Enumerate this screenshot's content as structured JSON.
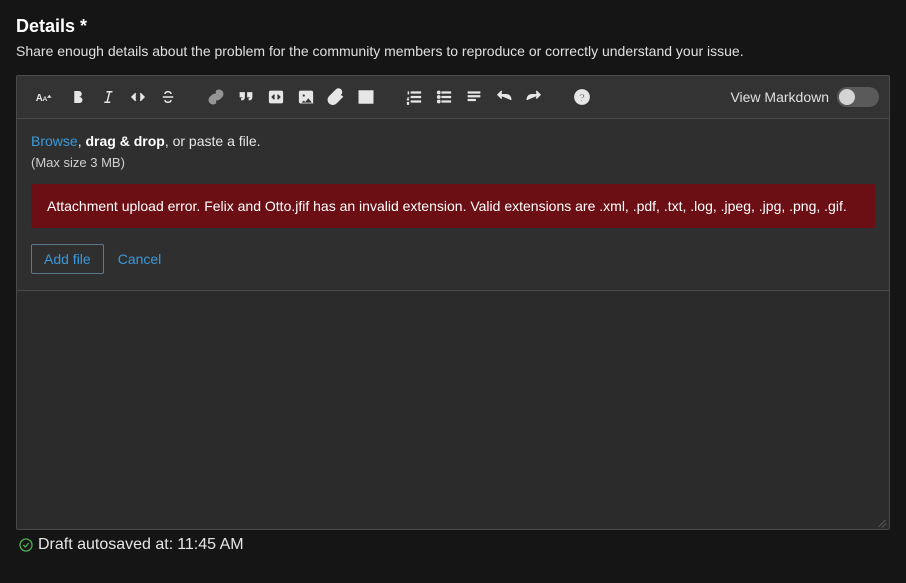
{
  "section": {
    "title": "Details *",
    "subtitle": "Share enough details about the problem for the community members to reproduce or correctly understand your issue."
  },
  "toolbar": {
    "view_markdown_label": "View Markdown",
    "view_markdown_on": false
  },
  "attach": {
    "browse_label": "Browse",
    "drag_drop_label": "drag & drop",
    "rest_text": ", or paste a file.",
    "max_size_text": "(Max size 3 MB)",
    "error_text": "Attachment upload error. Felix and Otto.jfif has an invalid extension. Valid extensions are .xml, .pdf, .txt, .log, .jpeg, .jpg, .png, .gif.",
    "add_file_label": "Add file",
    "cancel_label": "Cancel"
  },
  "autosave": {
    "prefix": "Draft autosaved at: ",
    "time": "11:45 AM"
  }
}
